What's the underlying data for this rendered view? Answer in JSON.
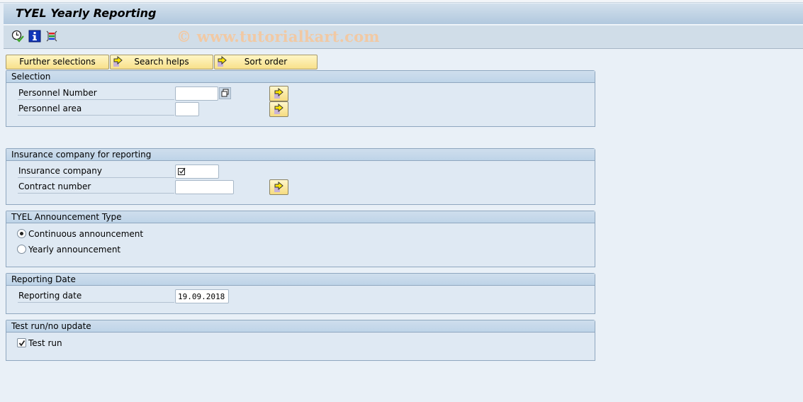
{
  "window": {
    "title": "TYEL Yearly Reporting",
    "watermark": "© www.tutorialkart.com"
  },
  "toolbar": {
    "icons": [
      {
        "name": "execute-icon",
        "tooltip": "Execute"
      },
      {
        "name": "info-icon",
        "tooltip": "Program documentation"
      },
      {
        "name": "selection-screen-icon",
        "tooltip": "Selection options"
      }
    ]
  },
  "buttons": {
    "further_selections": "Further selections",
    "search_helps": "Search helps",
    "sort_order": "Sort order"
  },
  "groups": {
    "selection": {
      "title": "Selection",
      "fields": [
        {
          "label": "Personnel Number",
          "value": ""
        },
        {
          "label": "Personnel area",
          "value": ""
        }
      ]
    },
    "insurance": {
      "title": "Insurance company for reporting",
      "fields": [
        {
          "label": "Insurance company",
          "value": "",
          "required": true
        },
        {
          "label": "Contract number",
          "value": ""
        }
      ]
    },
    "announcement": {
      "title": "TYEL Announcement Type",
      "options": [
        {
          "label": "Continuous announcement",
          "selected": true
        },
        {
          "label": "Yearly announcement",
          "selected": false
        }
      ]
    },
    "reporting_date": {
      "title": "Reporting Date",
      "fields": [
        {
          "label": "Reporting date",
          "value": "19.09.2018"
        }
      ]
    },
    "test_run": {
      "title": "Test run/no update",
      "checkbox": {
        "label": "Test run",
        "checked": true
      }
    }
  },
  "colors": {
    "button_yellow": "#f8e08a",
    "group_header": "#bed4e8",
    "background": "#e9f0f7"
  }
}
